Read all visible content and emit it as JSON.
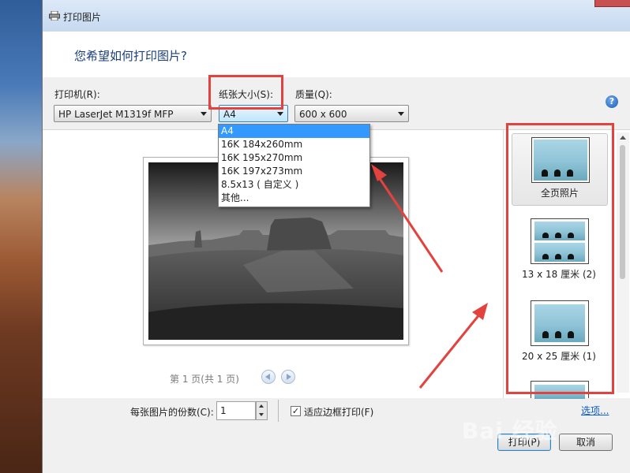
{
  "window": {
    "title": "打印图片",
    "question": "您希望如何打印图片?"
  },
  "printer": {
    "label": "打印机(R):",
    "value": "HP LaserJet M1319f MFP"
  },
  "paper_size": {
    "label": "纸张大小(S):",
    "value": "A4",
    "options": [
      "A4",
      "16K 184x260mm",
      "16K 195x270mm",
      "16K 197x273mm",
      "8.5x13 ( 自定义 )",
      "其他..."
    ]
  },
  "quality": {
    "label": "质量(Q):",
    "value": "600 x 600"
  },
  "help": {
    "glyph": "?"
  },
  "preview": {
    "page_info": "第 1 页(共 1 页)"
  },
  "layouts": [
    {
      "label": "全页照片",
      "selected": true
    },
    {
      "label": "13 x 18 厘米 (2)",
      "selected": false
    },
    {
      "label": "20 x 25 厘米 (1)",
      "selected": false
    }
  ],
  "copies": {
    "label": "每张图片的份数(C):",
    "value": "1"
  },
  "fit_frame": {
    "label": "适应边框打印(F)",
    "checked": true,
    "mark": "✓"
  },
  "options_link": "选项...",
  "buttons": {
    "print": "打印(P)",
    "cancel": "取消"
  },
  "watermark": "Bai 经验",
  "colors": {
    "highlight": "#3399ff",
    "annotation": "#e2433f",
    "link": "#0b5bd3"
  }
}
